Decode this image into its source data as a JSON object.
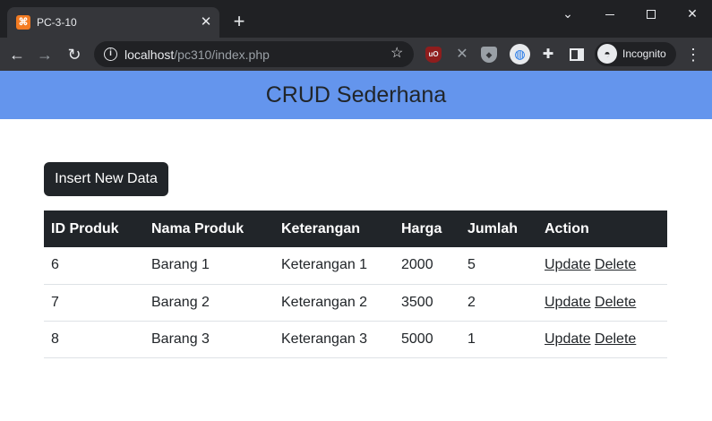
{
  "browser": {
    "tab_title": "PC-3-10",
    "url_host": "localhost",
    "url_path": "/pc310/index.php",
    "incognito_label": "Incognito",
    "extensions": [
      "ublock-icon",
      "x-icon",
      "shield-icon",
      "globe-icon",
      "puzzle-icon",
      "side-panel-icon"
    ]
  },
  "page": {
    "title": "CRUD Sederhana",
    "header_color": "#6495ed",
    "insert_button": "Insert New Data"
  },
  "table": {
    "headers": [
      "ID Produk",
      "Nama Produk",
      "Keterangan",
      "Harga",
      "Jumlah",
      "Action"
    ],
    "rows": [
      {
        "id": "6",
        "nama": "Barang 1",
        "keterangan": "Keterangan 1",
        "harga": "2000",
        "jumlah": "5",
        "update": "Update",
        "delete": "Delete"
      },
      {
        "id": "7",
        "nama": "Barang 2",
        "keterangan": "Keterangan 2",
        "harga": "3500",
        "jumlah": "2",
        "update": "Update",
        "delete": "Delete"
      },
      {
        "id": "8",
        "nama": "Barang 3",
        "keterangan": "Keterangan 3",
        "harga": "5000",
        "jumlah": "1",
        "update": "Update",
        "delete": "Delete"
      }
    ]
  }
}
